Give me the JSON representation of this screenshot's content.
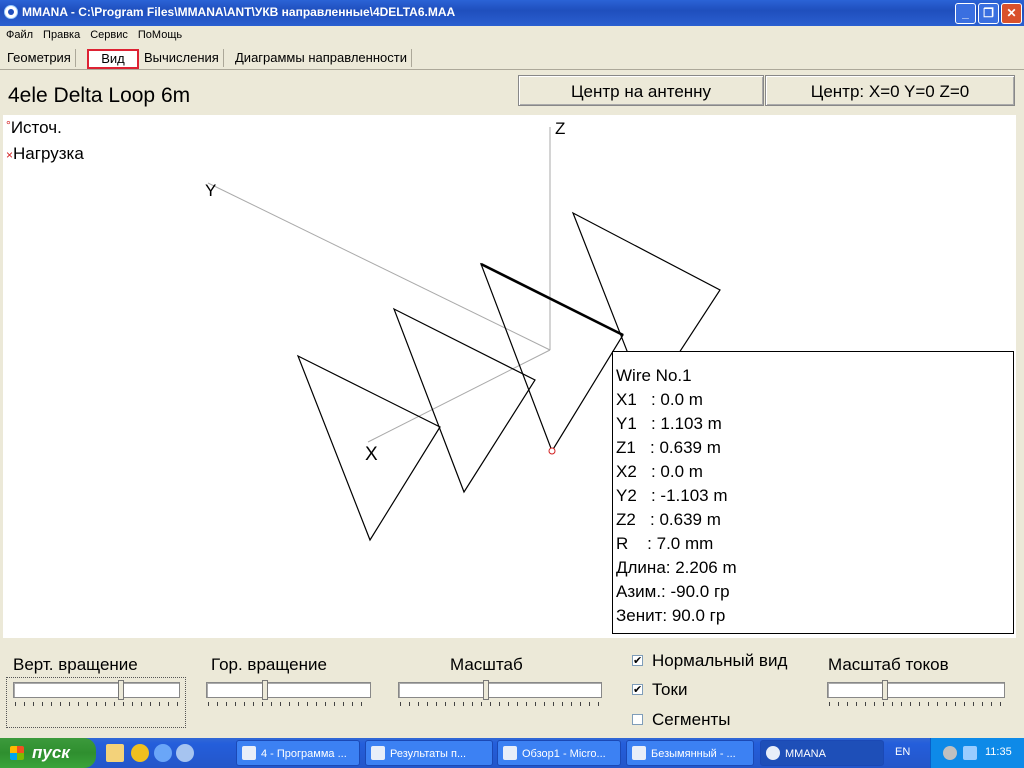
{
  "window": {
    "title": "MMANA - C:\\Program Files\\MMANA\\ANT\\УКВ направленные\\4DELTA6.MAA",
    "minimize": "_",
    "maximize": "❐",
    "close": "✕"
  },
  "menu": [
    "Файл",
    "Правка",
    "Сервис",
    "ПоМощь"
  ],
  "tabs": [
    "Геометрия",
    "Вид",
    "Вычисления",
    "Диаграммы направленности"
  ],
  "header": {
    "antenna_name": "4ele Delta Loop 6m",
    "center_button": "Центр на антенну",
    "center_readout": "Центр: X=0 Y=0 Z=0"
  },
  "legend": {
    "source_marker": "°",
    "source_label": "Источ.",
    "load_marker": "×",
    "load_label": "Нагрузка"
  },
  "axes": {
    "x": "X",
    "y": "Y",
    "z": "Z"
  },
  "wire_info": {
    "title": "Wire No.1",
    "lines": [
      "X1   : 0.0 m",
      "Y1   : 1.103 m",
      "Z1   : 0.639 m",
      "X2   : 0.0 m",
      "Y2   : -1.103 m",
      "Z2   : 0.639 m",
      "R    : 7.0 mm",
      "Длина: 2.206 m",
      "Азим.: -90.0 гр",
      "Зенит: 90.0 гр"
    ]
  },
  "controls": {
    "vert_rotation": {
      "label": "Верт. вращение",
      "position": 0.65
    },
    "hor_rotation": {
      "label": "Гор. вращение",
      "position": 0.35
    },
    "scale": {
      "label": "Масштаб",
      "position": 0.43
    },
    "current_scale": {
      "label": "Масштаб токов",
      "position": 0.32
    },
    "normal_view": {
      "label": "Нормальный вид",
      "checked": true,
      "mark": "✔"
    },
    "currents": {
      "label": "Токи",
      "checked": true,
      "mark": "✔"
    },
    "segments": {
      "label": "Сегменты",
      "checked": false,
      "mark": ""
    }
  },
  "taskbar": {
    "start": "пуск",
    "items": [
      {
        "label": "4 - Программа ...",
        "active": false
      },
      {
        "label": "Результаты п...",
        "active": false
      },
      {
        "label": "Обзор1 - Micro...",
        "active": false
      },
      {
        "label": "Безымянный - ...",
        "active": false
      },
      {
        "label": "MMANA",
        "active": true
      }
    ],
    "language": "EN",
    "clock": "11:35"
  },
  "colors": {
    "source_marker": "#d22020",
    "load_marker": "#d22020",
    "active_tab_border": "#dd2233"
  }
}
